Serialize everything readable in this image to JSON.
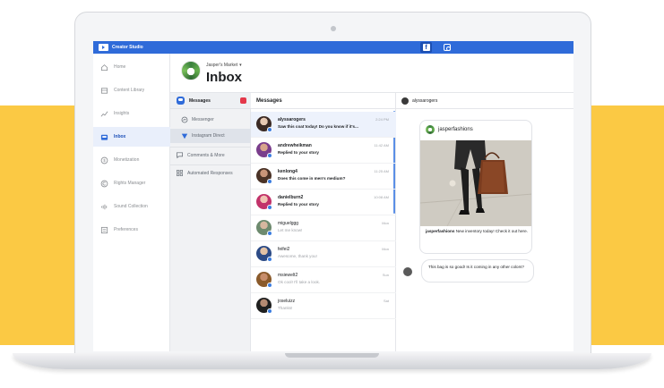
{
  "app": {
    "name": "Creator Studio"
  },
  "leftnav": {
    "items": [
      {
        "label": "Home",
        "icon": "home-icon"
      },
      {
        "label": "Content Library",
        "icon": "library-icon"
      },
      {
        "label": "Insights",
        "icon": "insights-icon"
      },
      {
        "label": "Inbox",
        "icon": "inbox-icon",
        "active": true
      },
      {
        "label": "Monetization",
        "icon": "dollar-icon"
      },
      {
        "label": "Rights Manager",
        "icon": "copyright-icon"
      },
      {
        "label": "Sound Collection",
        "icon": "sound-icon"
      },
      {
        "label": "Preferences",
        "icon": "preferences-icon"
      }
    ]
  },
  "header": {
    "page_name": "Jasper's Market",
    "title": "Inbox"
  },
  "subnav": {
    "messages_label": "Messages",
    "messenger_label": "Messenger",
    "instagram_label": "Instagram Direct",
    "comments_label": "Comments & More",
    "automated_label": "Automated Responses"
  },
  "messages": {
    "title": "Messages",
    "threads": [
      {
        "name": "alyssarogers",
        "preview": "Saw this coat today! Do you know if it's...",
        "time": "2:24 PM",
        "unread": true
      },
      {
        "name": "andrewheikman",
        "preview": "Replied to your story",
        "time": "11:42 AM",
        "unread": true
      },
      {
        "name": "kenlong4",
        "preview": "Does this come in men's medium?",
        "time": "11:25 AM",
        "unread": true
      },
      {
        "name": "danielburn2",
        "preview": "Replied to your story",
        "time": "10:08 AM",
        "unread": true
      },
      {
        "name": "miguelggg",
        "preview": "Let me know!",
        "time": "Mon",
        "unread": false
      },
      {
        "name": "feifei2",
        "preview": "Awesome, thank you!",
        "time": "Mon",
        "unread": false
      },
      {
        "name": "msiewelt2",
        "preview": "Ok cool! I'll take a look.",
        "time": "Sun",
        "unread": false
      },
      {
        "name": "joseluizz",
        "preview": "Thanks!",
        "time": "Sat",
        "unread": false
      }
    ]
  },
  "conversation": {
    "contact": "alyssarogers",
    "card_author": "jasperfashions",
    "caption_author": "jasperfashions",
    "caption_text": "New inventory today! Check it out here.",
    "reply": "This bag is so good! Is it coming in any other colors?"
  },
  "colors": {
    "accent": "#2f6bd9",
    "background_band": "#fbc944"
  }
}
